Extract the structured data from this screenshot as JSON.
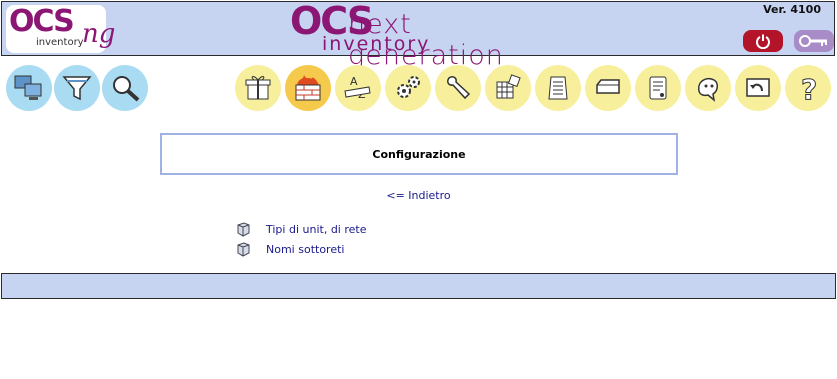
{
  "header": {
    "logo_left": {
      "ocs": "OCS",
      "ng": "ng",
      "inventory": "inventory"
    },
    "logo_center": {
      "ocs": "OCS",
      "next_generation": "next generation",
      "inventory": "inventory"
    },
    "version": "Ver. 4100",
    "logout_icon": "power-icon",
    "key_icon": "key-icon",
    "colors": {
      "bar": "#c6d3f1",
      "brand": "#8b1673",
      "logout": "#b3142a",
      "key": "#a78cc8"
    }
  },
  "toolbar": {
    "left_icons": [
      "computers-icon",
      "filter-icon",
      "search-icon"
    ],
    "right_icons": [
      "gift-icon",
      "firewall-icon",
      "dictionary-icon",
      "gears-icon",
      "wrench-icon",
      "software-icon",
      "documents-icon",
      "card-icon",
      "certificate-icon",
      "helpdesk-icon",
      "restore-icon",
      "help-icon"
    ],
    "active_icon": "firewall-icon"
  },
  "page": {
    "title": "Configurazione",
    "back_link": "<= Indietro",
    "items": [
      {
        "label": "Tipi di unit, di rete",
        "icon": "cube-icon"
      },
      {
        "label": "Nomi sottoreti",
        "icon": "cube-icon"
      }
    ]
  }
}
